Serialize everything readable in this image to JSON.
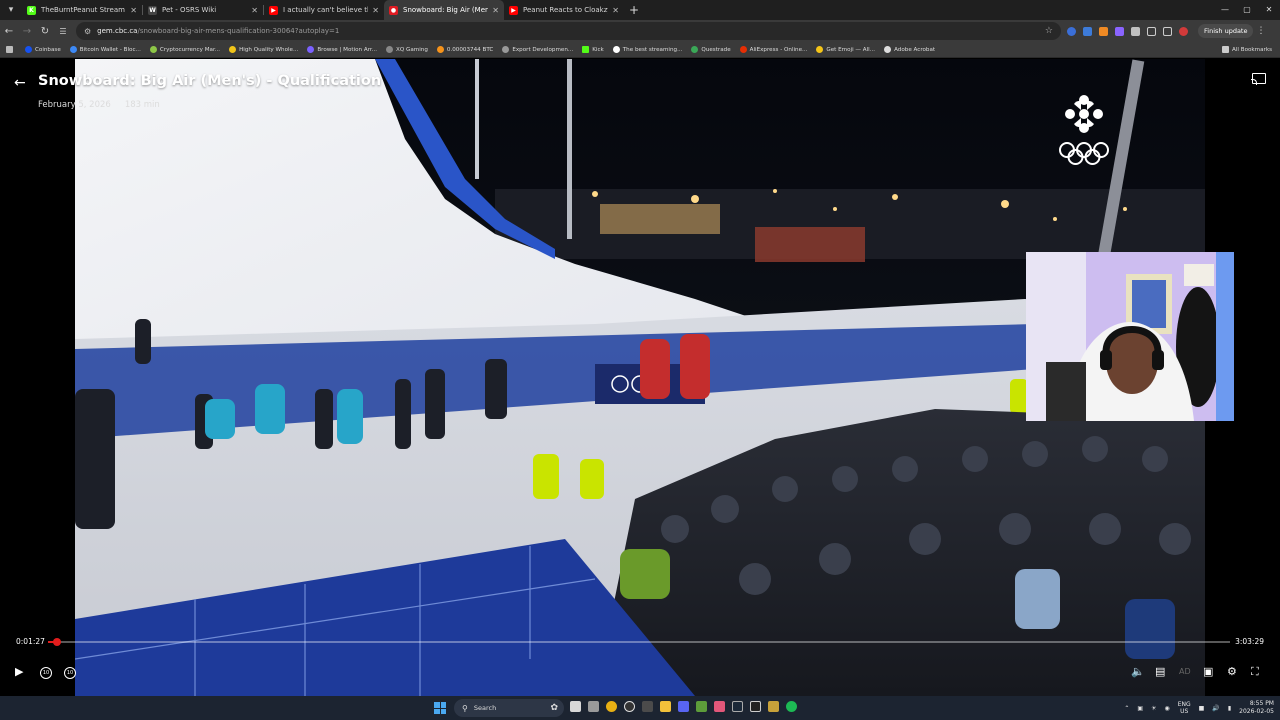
{
  "browser": {
    "tabs": [
      {
        "title": "TheBurntPeanut Stream - Watc",
        "fav": "K",
        "color": "#53fc18",
        "active": false
      },
      {
        "title": "Pet - OSRS Wiki",
        "fav": "W",
        "color": "#444444",
        "active": false
      },
      {
        "title": "I actually can't believe this... - Yo",
        "fav": "▶",
        "color": "#ff0000",
        "active": false
      },
      {
        "title": "Snowboard: Big Air (Men's) - Q",
        "fav": "●",
        "color": "#e01b22",
        "active": true
      },
      {
        "title": "Peanut Reacts to Cloakzy Slip U",
        "fav": "▶",
        "color": "#ff0000",
        "active": false
      }
    ],
    "new_tab": "+",
    "window_controls": {
      "minimize": "—",
      "maximize": "▢",
      "close": "✕"
    },
    "url": {
      "host": "gem.cbc.ca",
      "path": "/snowboard-big-air-mens-qualification-30064?autoplay=1"
    },
    "finish_update_label": "Finish update",
    "bookmarks": [
      {
        "label": "Coinbase",
        "color": "#1652f0"
      },
      {
        "label": "Bitcoin Wallet - Bloc...",
        "color": "#3d89f5"
      },
      {
        "label": "Cryptocurrency Mar...",
        "color": "#8dc647"
      },
      {
        "label": "High Quality Whole...",
        "color": "#f0c419"
      },
      {
        "label": "Browse | Motion Arr...",
        "color": "#7b61ff"
      },
      {
        "label": "XQ Gaming",
        "color": "#888888"
      },
      {
        "label": "0.00003744 BTC",
        "color": "#f7931a"
      },
      {
        "label": "Export Developmen...",
        "color": "#999999"
      },
      {
        "label": "Kick",
        "color": "#53fc18"
      },
      {
        "label": "The best streaming...",
        "color": "#ffffff"
      },
      {
        "label": "Questrade",
        "color": "#3aa757"
      },
      {
        "label": "AliExpress - Online...",
        "color": "#e62e04"
      },
      {
        "label": "Get Emoji — All...",
        "color": "#f5c518"
      },
      {
        "label": "Adobe Acrobat",
        "color": "#dddddd"
      }
    ],
    "all_bookmarks_label": "All Bookmarks"
  },
  "player": {
    "title": "Snowboard: Big Air (Men's) - Qualification",
    "date": "February 5, 2026",
    "duration": "183 min",
    "current_time": "0:01:27",
    "total_time": "3:03:29",
    "progress_fraction": 0.008
  },
  "taskbar": {
    "search_placeholder": "Search",
    "language": "ENG",
    "region": "US",
    "time": "8:55 PM",
    "date": "2026-02-05"
  }
}
